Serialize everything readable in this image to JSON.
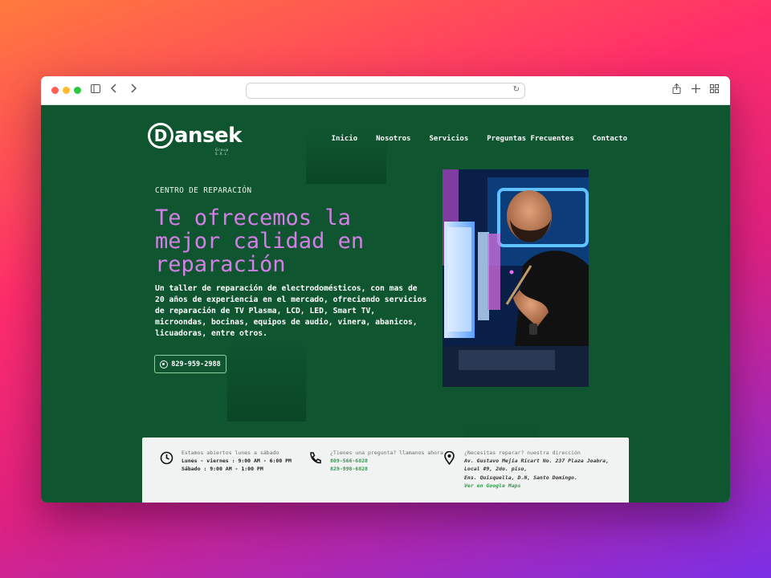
{
  "browser": {
    "url": "",
    "icons": [
      "sidebar-icon",
      "back-icon",
      "forward-icon",
      "reload-icon",
      "share-icon",
      "new-tab-icon",
      "tab-overview-icon"
    ]
  },
  "logo": {
    "name": "Dansek",
    "first_letter": "D",
    "rest": "ansek",
    "sub": "Group S.R.L."
  },
  "nav": [
    "Inicio",
    "Nosotros",
    "Servicios",
    "Preguntas Frecuentes",
    "Contacto"
  ],
  "hero": {
    "eyebrow": "CENTRO DE REPARACIÓN",
    "headline": "Te ofrecemos la mejor calidad en reparación",
    "description": "Un taller de reparación de electrodomésticos, con mas de 20 años de experiencia en el mercado, ofreciendo servicios de reparación de TV Plasma, LCD, LED, Smart TV, microondas, bocinas, equipos de audio, vinera, abanicos, licuadoras, entre otros.",
    "phone_button": "829-959-2988"
  },
  "info": {
    "hours": {
      "label": "Estamos abiertos lunes a sábado",
      "weekdays": "Lunes - viernes : 9:00 AM - 6:00 PM",
      "saturday": "Sábado : 9:00 AM - 1:00 PM"
    },
    "contact": {
      "label": "¿Tienes una pregunta? llamanos ahora",
      "phone1": "809-566-6828",
      "phone2": "829-998-6828"
    },
    "address": {
      "label": "¿Necesitas reparar? nuestra dirección",
      "line1": "Av. Gustavo Mejía Ricart No. 237 Plaza Joabra,",
      "line2": "Local #9, 2do. piso,",
      "line3": "Ens. Quisquella, D.N, Santo Domingo.",
      "map_link": "Ver en Google Maps"
    }
  },
  "colors": {
    "page_bg": "#0f5630",
    "headline": "#d57ee8",
    "link_green": "#2e9a4e",
    "info_bg": "#f1f2f2"
  }
}
